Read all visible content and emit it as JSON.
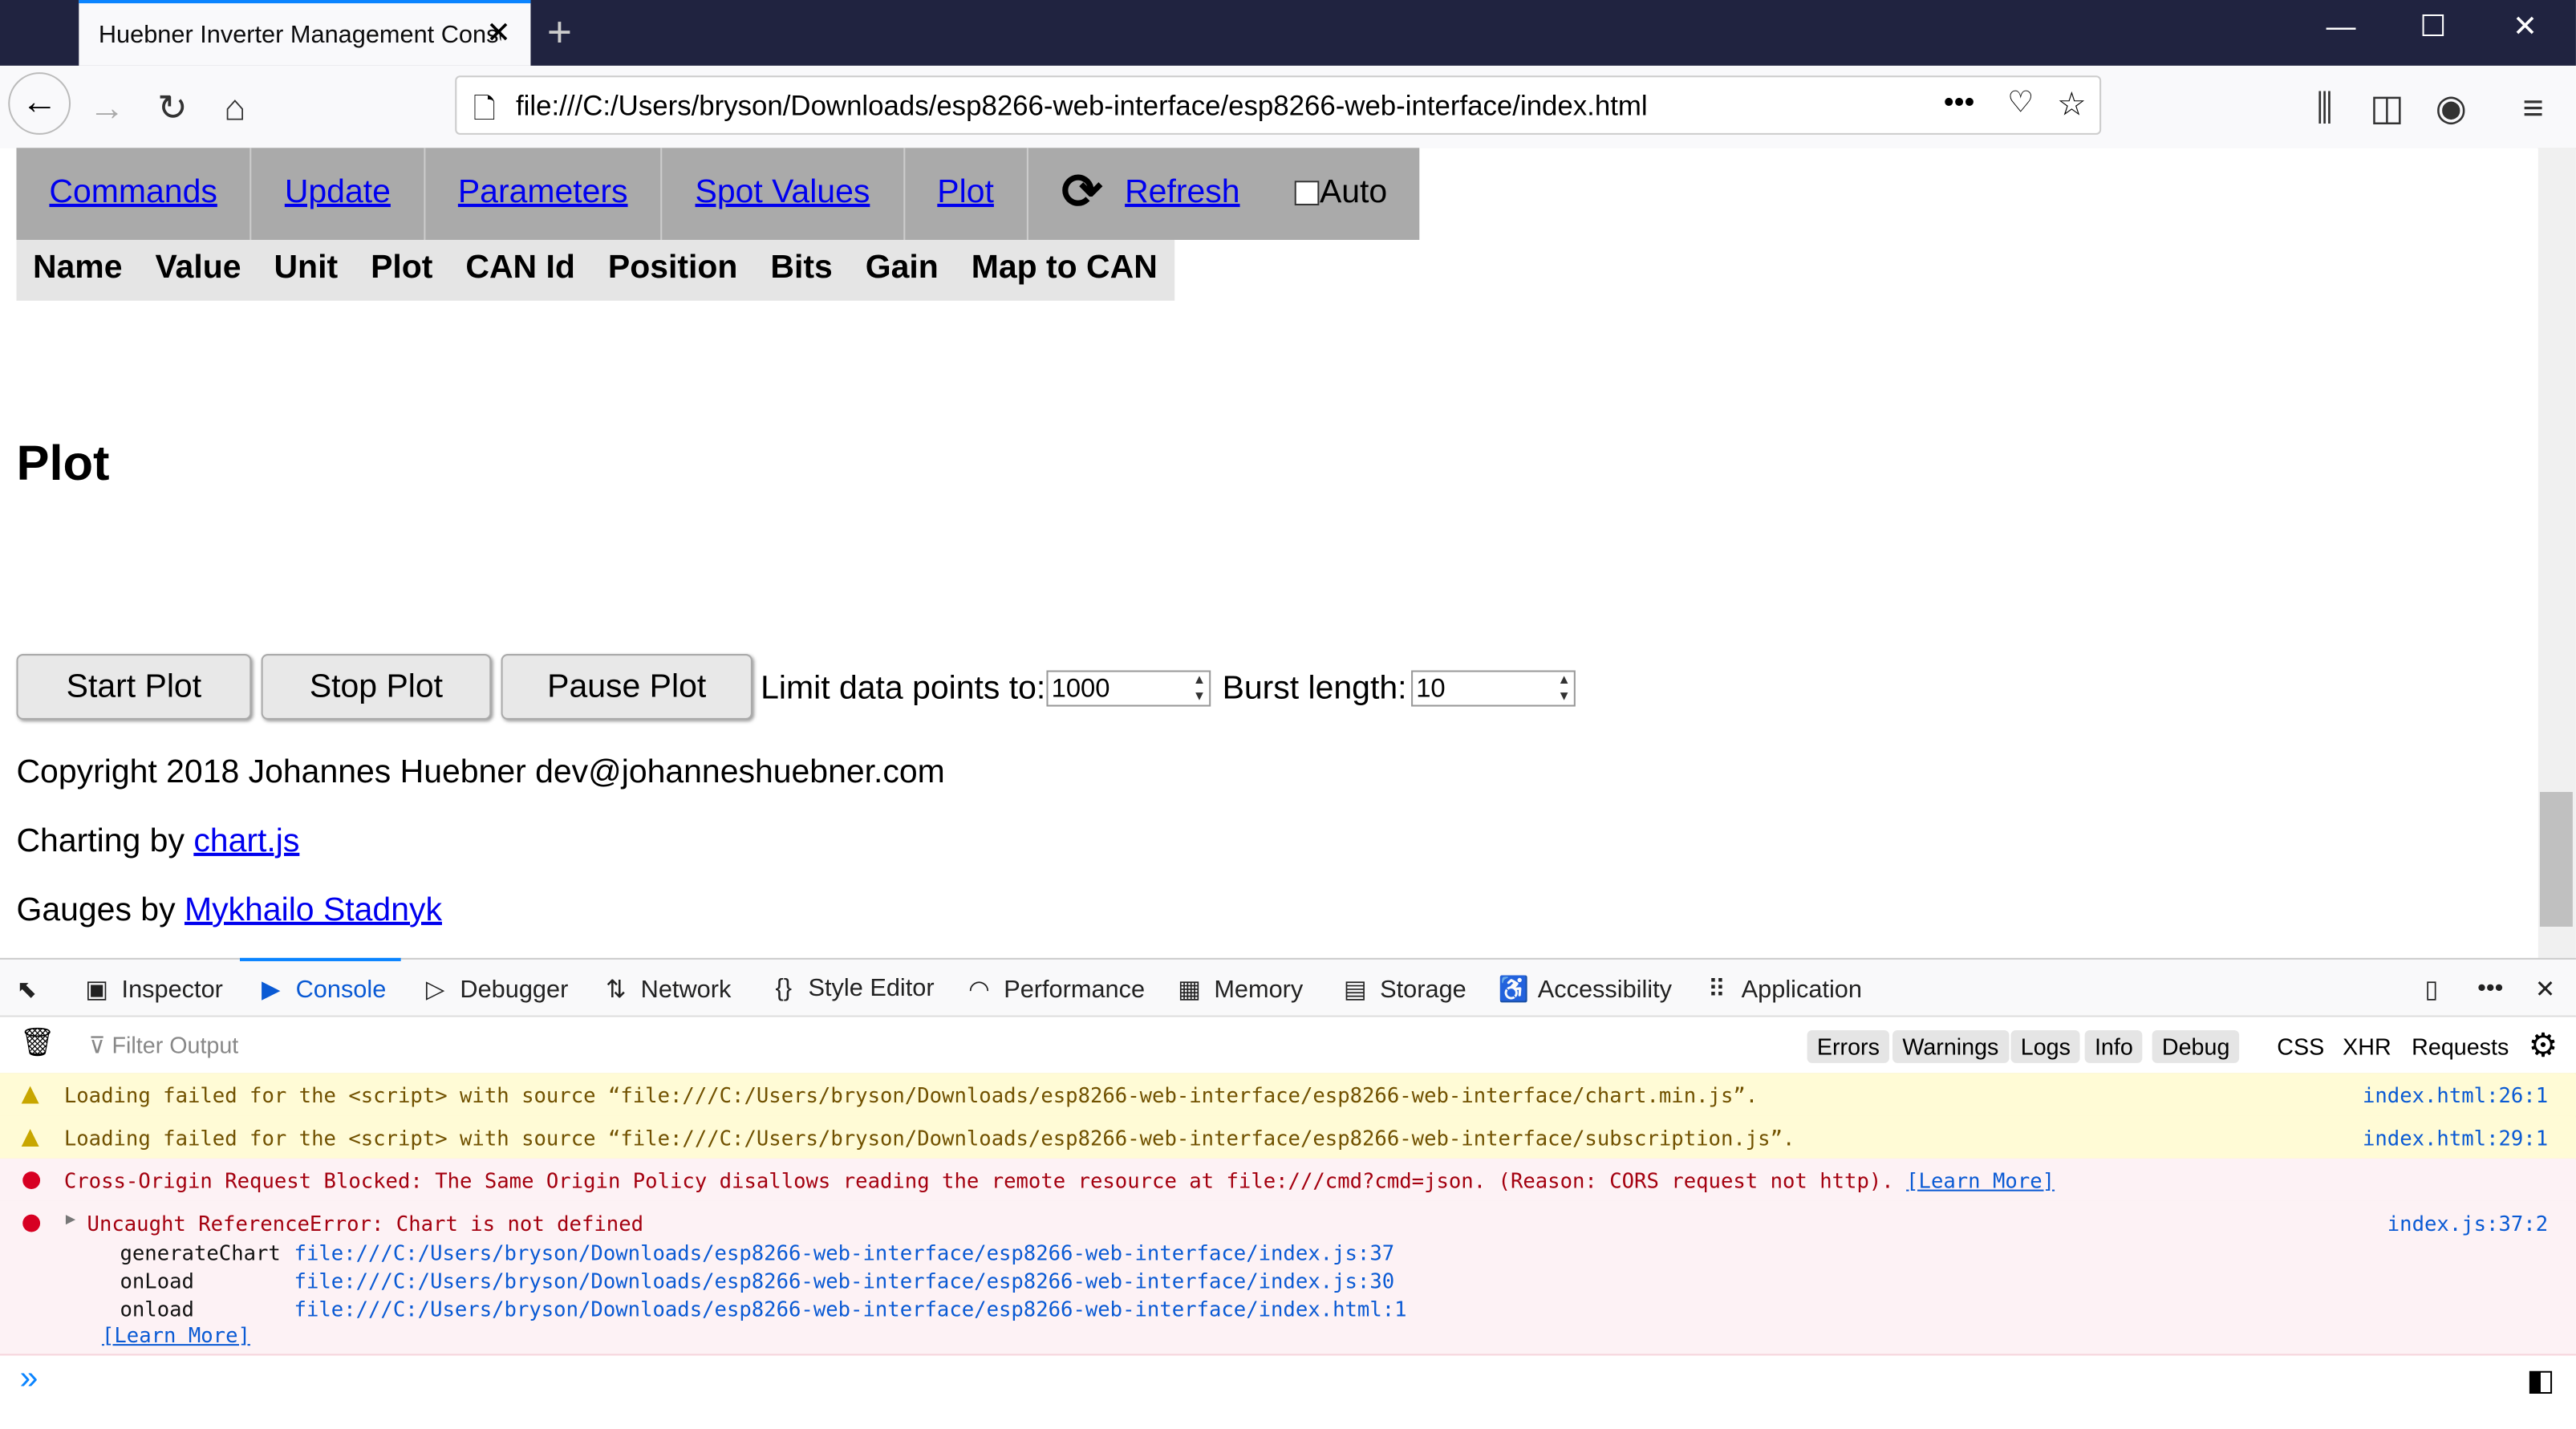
{
  "browser": {
    "tab_title": "Huebner Inverter Management Console",
    "url": "file:///C:/Users/bryson/Downloads/esp8266-web-interface/esp8266-web-interface/index.html"
  },
  "menu": {
    "items": [
      "Commands",
      "Update",
      "Parameters",
      "Spot Values",
      "Plot"
    ],
    "refresh": "Refresh",
    "auto": "Auto",
    "auto_checked": false
  },
  "table_headers": [
    "Name",
    "Value",
    "Unit",
    "Plot",
    "CAN Id",
    "Position",
    "Bits",
    "Gain",
    "Map to CAN"
  ],
  "plot": {
    "heading": "Plot",
    "start": "Start Plot",
    "stop": "Stop Plot",
    "pause": "Pause Plot",
    "limit_label": "Limit data points to:",
    "limit_value": "1000",
    "burst_label": "Burst length:",
    "burst_value": "10"
  },
  "footer": {
    "copyright": "Copyright 2018 Johannes Huebner dev@johanneshuebner.com",
    "charting_prefix": "Charting by ",
    "charting_link": "chart.js",
    "gauges_prefix": "Gauges by ",
    "gauges_link": "Mykhailo Stadnyk"
  },
  "devtools": {
    "tabs": [
      "Inspector",
      "Console",
      "Debugger",
      "Network",
      "Style Editor",
      "Performance",
      "Memory",
      "Storage",
      "Accessibility",
      "Application"
    ],
    "filter_placeholder": "Filter Output",
    "filters": [
      "Errors",
      "Warnings",
      "Logs",
      "Info",
      "Debug"
    ],
    "extra_filters": [
      "CSS",
      "XHR",
      "Requests"
    ],
    "messages": [
      {
        "type": "warning",
        "text": "Loading failed for the <script> with source “file:///C:/Users/bryson/Downloads/esp8266-web-interface/esp8266-web-interface/chart.min.js”.",
        "source": "index.html:26:1"
      },
      {
        "type": "warning",
        "text": "Loading failed for the <script> with source “file:///C:/Users/bryson/Downloads/esp8266-web-interface/esp8266-web-interface/subscription.js”.",
        "source": "index.html:29:1"
      },
      {
        "type": "error",
        "text": "Cross-Origin Request Blocked: The Same Origin Policy disallows reading the remote resource at file:///cmd?cmd=json. (Reason: CORS request not http).",
        "link": "[Learn More]"
      },
      {
        "type": "error",
        "text": "Uncaught ReferenceError: Chart is not defined",
        "source": "index.js:37:2",
        "link": "[Learn More]",
        "trace": [
          {
            "fn": "generateChart",
            "loc": "file:///C:/Users/bryson/Downloads/esp8266-web-interface/esp8266-web-interface/index.js:37"
          },
          {
            "fn": "onLoad",
            "loc": "file:///C:/Users/bryson/Downloads/esp8266-web-interface/esp8266-web-interface/index.js:30"
          },
          {
            "fn": "onload",
            "loc": "file:///C:/Users/bryson/Downloads/esp8266-web-interface/esp8266-web-interface/index.html:1"
          }
        ]
      }
    ]
  }
}
